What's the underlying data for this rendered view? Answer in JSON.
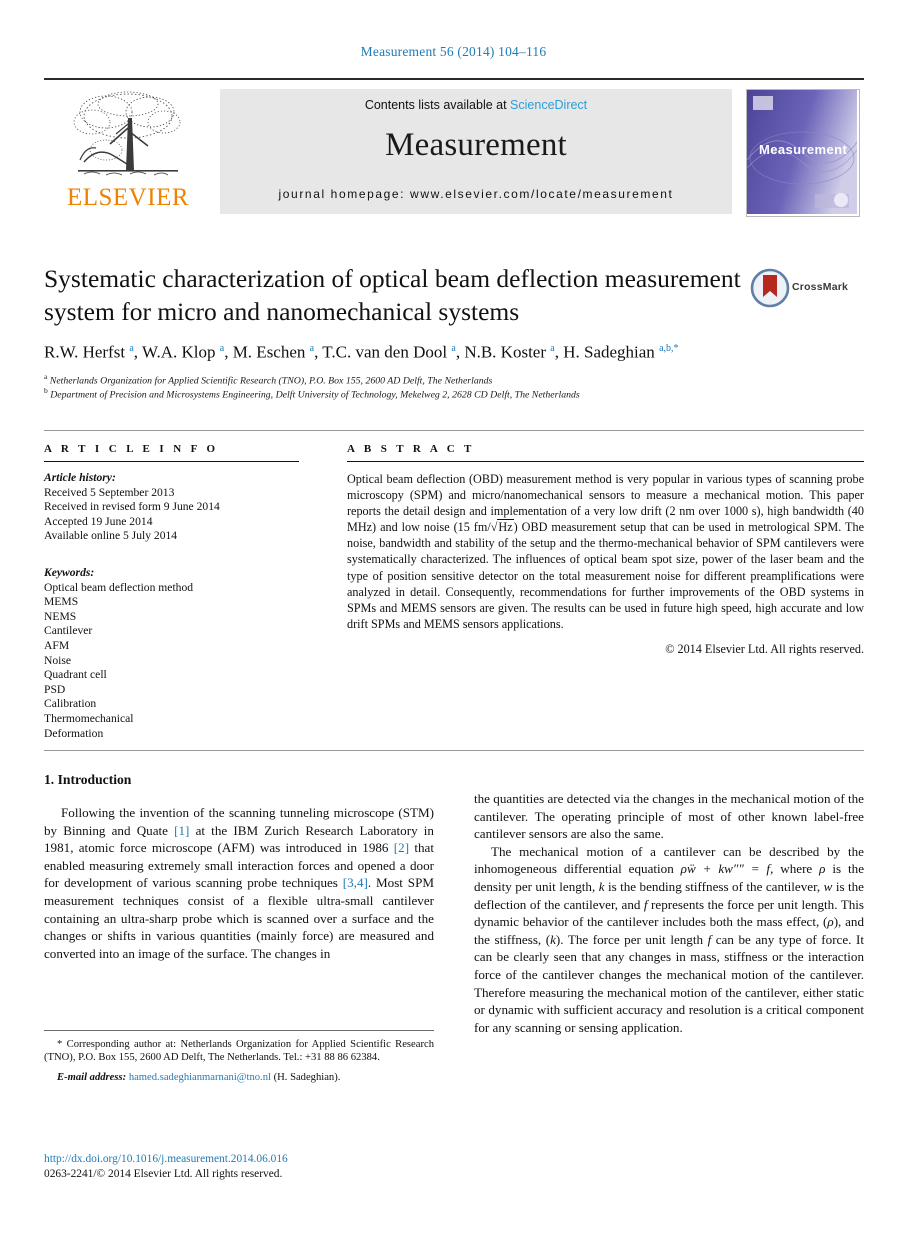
{
  "running_head": "Measurement 56 (2014) 104–116",
  "masthead": {
    "contents_prefix": "Contents lists available at ",
    "sciencedirect": "ScienceDirect",
    "journal_name": "Measurement",
    "homepage": "journal homepage: www.elsevier.com/locate/measurement",
    "publisher_logo_text": "ELSEVIER",
    "cover_title": "Measurement",
    "colors": {
      "link_blue": "#2b9fd8",
      "elsevier_orange": "#ef8200",
      "masthead_gray": "#e7e7e7",
      "cover_purple": "#5b54a8"
    }
  },
  "title_block": {
    "title": "Systematic characterization of optical beam deflection measurement system for micro and nanomechanical systems",
    "crossmark_label": "CrossMark",
    "authors_html": "R.W. Herfst <sup>a</sup>, W.A. Klop <sup>a</sup>, M. Eschen <sup>a</sup>, T.C. van den Dool <sup>a</sup>, N.B. Koster <sup>a</sup>, H. Sadeghian <sup>a,b,</sup><sup>*</sup>",
    "affiliation_a": "Netherlands Organization for Applied Scientific Research (TNO), P.O. Box 155, 2600 AD Delft, The Netherlands",
    "affiliation_b": "Department of Precision and Microsystems Engineering, Delft University of Technology, Mekelweg 2, 2628 CD Delft, The Netherlands"
  },
  "article_info": {
    "heading": "A R T I C L E    I N F O",
    "history_label": "Article history:",
    "history": [
      "Received 5 September 2013",
      "Received in revised form 9 June 2014",
      "Accepted 19 June 2014",
      "Available online 5 July 2014"
    ],
    "keywords_label": "Keywords:",
    "keywords": [
      "Optical beam deflection method",
      "MEMS",
      "NEMS",
      "Cantilever",
      "AFM",
      "Noise",
      "Quadrant cell",
      "PSD",
      "Calibration",
      "Thermomechanical",
      "Deformation"
    ]
  },
  "abstract": {
    "heading": "A B S T R A C T",
    "text_part1": "Optical beam deflection (OBD) measurement method is very popular in various types of scanning probe microscopy (SPM) and micro/nanomechanical sensors to measure a mechanical motion. This paper reports the detail design and implementation of a very low drift (2 nm over 1000 s), high bandwidth (40 MHz) and low noise (15 fm/",
    "sqrt_radicand": "Hz",
    "text_part2": ") OBD measurement setup that can be used in metrological SPM. The noise, bandwidth and stability of the setup and the thermo-mechanical behavior of SPM cantilevers were systematically characterized. The influences of optical beam spot size, power of the laser beam and the type of position sensitive detector on the total measurement noise for different preamplifications were analyzed in detail. Consequently, recommendations for further improvements of the OBD systems in SPMs and MEMS sensors are given. The results can be used in future high speed, high accurate and low drift SPMs and MEMS sensors applications.",
    "copyright": "© 2014 Elsevier Ltd. All rights reserved."
  },
  "body": {
    "section_title": "1. Introduction",
    "left_p1_a": "Following the invention of the scanning tunneling microscope (STM) by Binning and Quate ",
    "left_p1_ref1": "[1]",
    "left_p1_b": " at the IBM Zurich Research Laboratory in 1981, atomic force microscope (AFM) was introduced in 1986 ",
    "left_p1_ref2": "[2]",
    "left_p1_c": " that enabled measuring extremely small interaction forces and opened a door for development of various scanning probe techniques ",
    "left_p1_ref3": "[3,4]",
    "left_p1_d": ". Most SPM measurement techniques consist of a flexible ultra-small cantilever containing an ultra-sharp probe which is scanned over a surface and the changes or shifts in various quantities (mainly force) are measured and converted into an image of the surface. The changes in",
    "right_p1": "the quantities are detected via the changes in the mechanical motion of the cantilever. The operating principle of most of other known label-free cantilever sensors are also the same.",
    "right_p2_a": "The mechanical motion of a cantilever can be described by the inhomogeneous differential equation ",
    "right_p2_eq": "ρẅ + kw″″ = f",
    "right_p2_b": ", where ",
    "right_p2_rho": "ρ",
    "right_p2_c": " is the density per unit length, ",
    "right_p2_k": "k",
    "right_p2_d": " is the bending stiffness of the cantilever, ",
    "right_p2_w": "w",
    "right_p2_e": " is the deflection of the cantilever, and ",
    "right_p2_f": "f",
    "right_p2_g": " represents the force per unit length. This dynamic behavior of the cantilever includes both the mass effect, (",
    "right_p2_rho2": "ρ",
    "right_p2_h": "), and the stiffness, (",
    "right_p2_k2": "k",
    "right_p2_i": "). The force per unit length ",
    "right_p2_f2": "f",
    "right_p2_j": " can be any type of force. It can be clearly seen that any changes in mass, stiffness or the interaction force of the cantilever changes the mechanical motion of the cantilever. Therefore measuring the mechanical motion of the cantilever, either static or dynamic with sufficient accuracy and resolution is a critical component for any scanning or sensing application."
  },
  "footnote": {
    "corresponding_marker": "*",
    "corresponding_text": " Corresponding author at: Netherlands Organization for Applied Scientific Research (TNO), P.O. Box 155, 2600 AD Delft, The Netherlands. Tel.: +31 88 86 62384.",
    "email_label": "E-mail address:",
    "email": "hamed.sadeghianmarnani@tno.nl",
    "email_suffix": " (H. Sadeghian).",
    "doi": "http://dx.doi.org/10.1016/j.measurement.2014.06.016",
    "issn": "0263-2241/© 2014 Elsevier Ltd. All rights reserved."
  }
}
